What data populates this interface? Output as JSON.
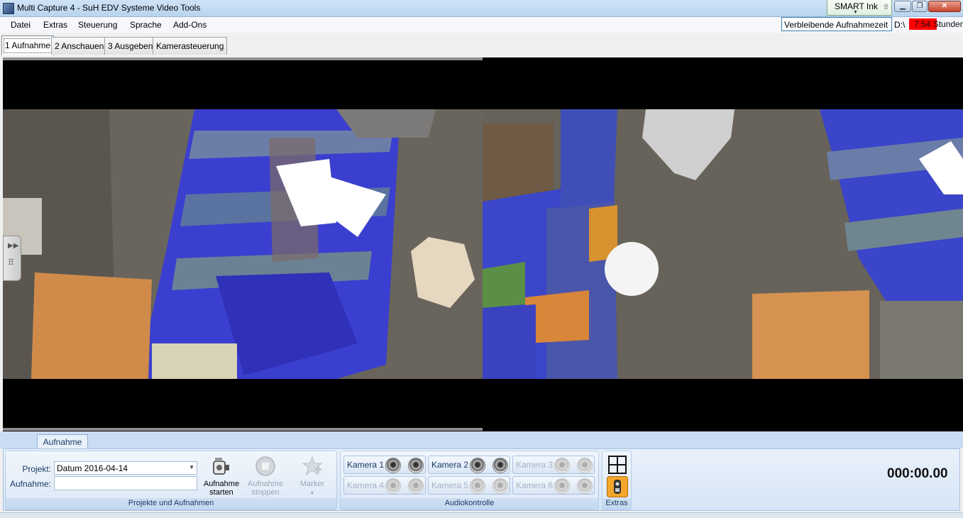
{
  "window": {
    "title": "Multi Capture 4 - SuH EDV Systeme Video Tools",
    "smart_ink": "SMART Ink"
  },
  "menu": [
    "Datei",
    "Extras",
    "Steuerung",
    "Sprache",
    "Add-Ons"
  ],
  "status": {
    "remaining_label": "Verbleibende Aufnahmezeit",
    "drive": "D:\\",
    "hours": "7:54 Stunden"
  },
  "tabs": [
    "1 Aufnahme",
    "2 Anschauen",
    "3 Ausgeben",
    "Kamerasteuerung"
  ],
  "ribbon": {
    "tab": "Aufnahme",
    "projects": {
      "projekt_label": "Projekt:",
      "projekt_value": "Datum 2016-04-14",
      "aufnahme_label": "Aufnahme:",
      "aufnahme_value": "",
      "start_line1": "Aufnahme",
      "start_line2": "starten",
      "stop_line1": "Aufnahme",
      "stop_line2": "stoppen",
      "marker": "Marker",
      "group_label": "Projekte und Aufnahmen"
    },
    "audio": {
      "cameras": [
        "Kamera 1",
        "Kamera 2",
        "Kamera 3",
        "Kamera 4",
        "Kamera 5",
        "Kamera 6"
      ],
      "group_label": "Audiokontrolle"
    },
    "extras": {
      "group_label": "Extras"
    }
  },
  "timer": "000:00.00",
  "colors": {
    "accent": "#3c7fb1",
    "recording_time_bg": "#ff0000",
    "ribbon": "#d6e5f6"
  },
  "icons": {
    "start": "camcorder-icon",
    "stop": "stop-icon",
    "marker": "star-plus-icon",
    "layout": "grid-icon",
    "extras": "remote-icon"
  }
}
